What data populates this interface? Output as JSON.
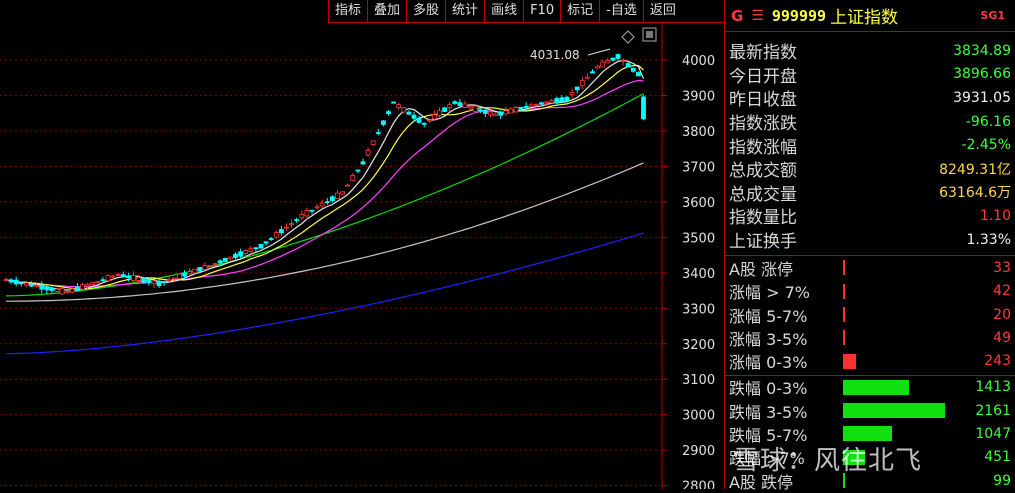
{
  "toolbar": {
    "buttons": [
      "指标",
      "叠加",
      "多股",
      "统计",
      "画线",
      "F10",
      "标记",
      "-自选",
      "返回"
    ]
  },
  "chart": {
    "y_ticks": [
      4000,
      3900,
      3800,
      3700,
      3600,
      3500,
      3400,
      3300,
      3200,
      3100,
      3000,
      2900,
      2800
    ],
    "high_label": "4031.08",
    "colors": {
      "up": "#ff3a3a",
      "down": "#00ffff",
      "ma5": "#e8e8e8",
      "ma10": "#ffff40",
      "ma20": "#ff40ff",
      "ma60": "#00e000",
      "ma120": "#c8c8c8",
      "ma250": "#2020ff",
      "grid": "#8a0000"
    }
  },
  "panel": {
    "header": {
      "g": "G",
      "menu_icon": "menu-icon",
      "code": "999999",
      "name": "上证指数",
      "sg": "SG1"
    },
    "stats": [
      {
        "label": "最新指数",
        "value": "3834.89",
        "color": "down"
      },
      {
        "label": "今日开盘",
        "value": "3896.66",
        "color": "down"
      },
      {
        "label": "昨日收盘",
        "value": "3931.05",
        "color": "white"
      },
      {
        "label": "指数涨跌",
        "value": "-96.16",
        "color": "down"
      },
      {
        "label": "指数涨幅",
        "value": "-2.45%",
        "color": "down"
      },
      {
        "label": "总成交额",
        "value": "8249.31亿",
        "color": "yellow"
      },
      {
        "label": "总成交量",
        "value": "63164.6万",
        "color": "yellow"
      },
      {
        "label": "指数量比",
        "value": "1.10",
        "color": "up"
      },
      {
        "label": "上证换手",
        "value": "1.33%",
        "color": "white"
      }
    ],
    "rise": [
      {
        "label": "A股 涨停",
        "value": "33",
        "bar_fraction": 0.01
      },
      {
        "label": "涨幅 > 7%",
        "value": "42",
        "bar_fraction": 0.01
      },
      {
        "label": "涨幅 5-7%",
        "value": "20",
        "bar_fraction": 0.01
      },
      {
        "label": "涨幅 3-5%",
        "value": "49",
        "bar_fraction": 0.01
      },
      {
        "label": "涨幅 0-3%",
        "value": "243",
        "bar_fraction": 0.11
      }
    ],
    "fall": [
      {
        "label": "跌幅 0-3%",
        "value": "1413",
        "bar_fraction": 0.55
      },
      {
        "label": "跌幅 3-5%",
        "value": "2161",
        "bar_fraction": 0.85
      },
      {
        "label": "跌幅 5-7%",
        "value": "1047",
        "bar_fraction": 0.41
      },
      {
        "label": "跌幅 >7%",
        "value": "451",
        "bar_fraction": 0.18
      },
      {
        "label": "A股 跌停",
        "value": "99",
        "bar_fraction": 0.02
      }
    ],
    "watermark": "雪球：风往北飞"
  }
}
